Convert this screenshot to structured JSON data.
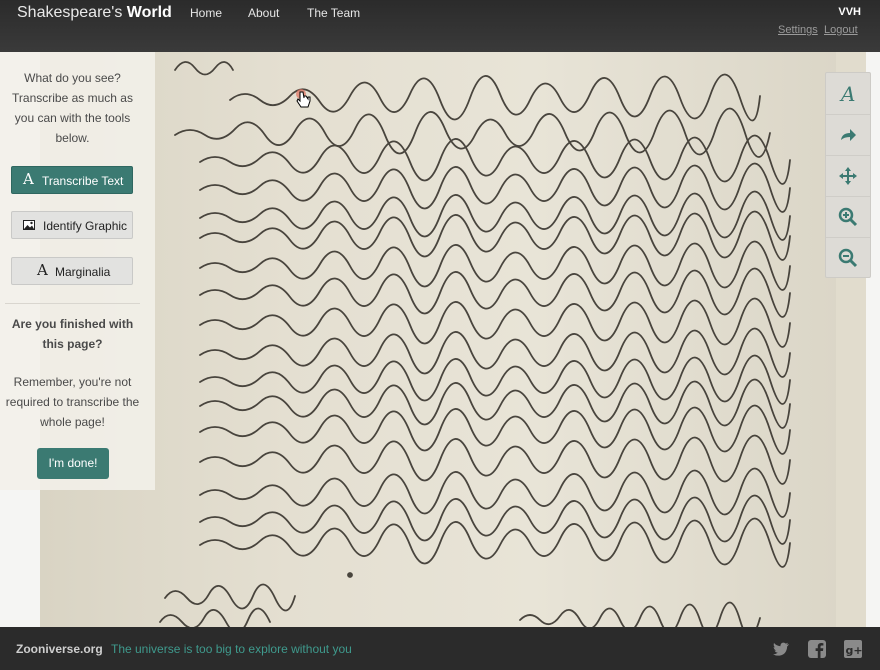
{
  "header": {
    "brand_light": "Shakespeare's ",
    "brand_bold": "World",
    "nav": [
      "Home",
      "About",
      "The Team"
    ],
    "user": "VVH",
    "settings": "Settings",
    "logout": "Logout"
  },
  "sidebar": {
    "prompt": "What do you see? Transcribe as much as you can with the tools below.",
    "buttons": {
      "transcribe_text": "Transcribe Text",
      "identify_graphic": "Identify Graphic",
      "marginalia": "Marginalia"
    },
    "finished_question": "Are you finished with this page?",
    "reminder": "Remember, you're not required to transcribe the whole page!",
    "done": "I'm done!"
  },
  "toolbar": {
    "tools": [
      "text-tool-icon",
      "redo-icon",
      "pan-icon",
      "zoom-in-icon",
      "zoom-out-icon"
    ]
  },
  "footer": {
    "site": "Zooniverse.org",
    "tagline": "The universe is too big to explore without you",
    "social": [
      "twitter-icon",
      "facebook-icon",
      "google-plus-icon"
    ]
  },
  "colors": {
    "accent": "#3b7a72",
    "header_bg": "#2b2b2b",
    "paper": "#e4dfd1",
    "ink": "#2e2a24"
  }
}
